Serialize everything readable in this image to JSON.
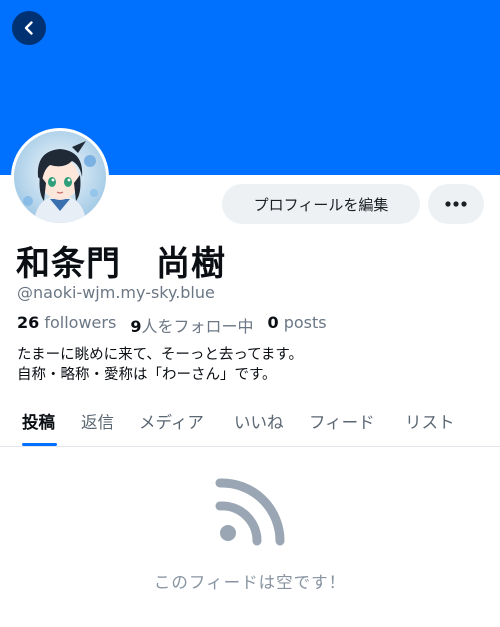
{
  "header": {
    "back_icon": "chevron-left-icon",
    "banner_color": "#0070ff"
  },
  "profile": {
    "avatar_icon": "anime-character-avatar",
    "display_name": "和条門　尚樹",
    "handle": "@naoki-wjm.my-sky.blue",
    "edit_label": "プロフィールを編集",
    "more_icon": "ellipsis-icon",
    "stats": {
      "followers_count": "26",
      "followers_label": "followers",
      "following_count": "9",
      "following_label": "人をフォロー中",
      "posts_count": "0",
      "posts_label": "posts"
    },
    "bio_line1": "たまーに眺めに来て、そーっと去ってます。",
    "bio_line2": "自称・略称・愛称は「わーさん」です。"
  },
  "tabs": [
    {
      "label": "投稿",
      "active": true
    },
    {
      "label": "返信",
      "active": false
    },
    {
      "label": "メディア",
      "active": false
    },
    {
      "label": "いいね",
      "active": false
    },
    {
      "label": "フィード",
      "active": false
    },
    {
      "label": "リスト",
      "active": false
    }
  ],
  "empty_state": {
    "icon": "rss-feed-icon",
    "message": "このフィードは空です！"
  },
  "colors": {
    "accent": "#0070ff",
    "muted": "#6b7785",
    "button_bg": "#eef1f3"
  }
}
